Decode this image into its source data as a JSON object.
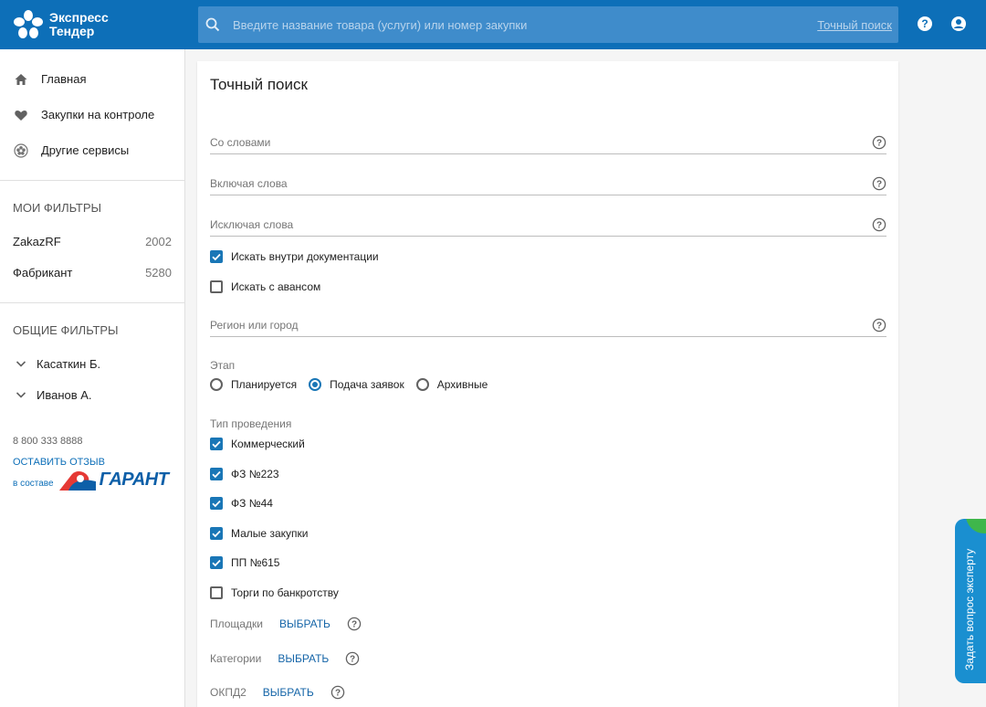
{
  "header": {
    "logo_line1": "Экспресс",
    "logo_line2": "Тендер",
    "search_placeholder": "Введите название товара (услуги) или номер закупки",
    "exact_search_link": "Точный поиск",
    "help_icon": "question-circle-icon",
    "account_icon": "account-circle-icon",
    "colors": {
      "bar": "#0d6fb8",
      "search": "#3f8ccb"
    }
  },
  "sidebar": {
    "nav": [
      {
        "label": "Главная",
        "icon": "home-icon"
      },
      {
        "label": "Закупки на контроле",
        "icon": "heart-icon"
      },
      {
        "label": "Другие сервисы",
        "icon": "services-icon"
      }
    ],
    "my_filters_title": "МОИ ФИЛЬТРЫ",
    "my_filters": [
      {
        "name": "ZakazRF",
        "count": "2002"
      },
      {
        "name": "Фабрикант",
        "count": "5280"
      }
    ],
    "common_filters_title": "ОБЩИЕ ФИЛЬТРЫ",
    "common_filters": [
      {
        "name": "Касаткин Б."
      },
      {
        "name": "Иванов А."
      }
    ],
    "phone": "8 800 333 8888",
    "feedback": "ОСТАВИТЬ ОТЗЫВ",
    "partner_prefix": "в составе",
    "partner_name": "ГАРАНТ"
  },
  "form": {
    "title": "Точный поиск",
    "with_words": "Со словами",
    "including_words": "Включая слова",
    "excluding_words": "Исключая слова",
    "search_in_docs": {
      "label": "Искать внутри документации",
      "checked": true
    },
    "with_advance": {
      "label": "Искать с авансом",
      "checked": false
    },
    "region": "Регион или город",
    "stage_label": "Этап",
    "stages": [
      {
        "label": "Планируется",
        "selected": false
      },
      {
        "label": "Подача заявок",
        "selected": true
      },
      {
        "label": "Архивные",
        "selected": false
      }
    ],
    "type_label": "Тип проведения",
    "types": [
      {
        "label": "Коммерческий",
        "checked": true
      },
      {
        "label": "ФЗ №223",
        "checked": true
      },
      {
        "label": "ФЗ №44",
        "checked": true
      },
      {
        "label": "Малые закупки",
        "checked": true
      },
      {
        "label": "ПП №615",
        "checked": true
      },
      {
        "label": "Торги по банкротству",
        "checked": false
      }
    ],
    "platforms_label": "Площадки",
    "categories_label": "Категории",
    "okpd_label": "ОКПД2",
    "choose": "ВЫБРАТЬ",
    "accent": "#1976b6"
  },
  "expert_tab": {
    "label": "Задать вопрос эксперту",
    "color": "#1a8fd0"
  }
}
